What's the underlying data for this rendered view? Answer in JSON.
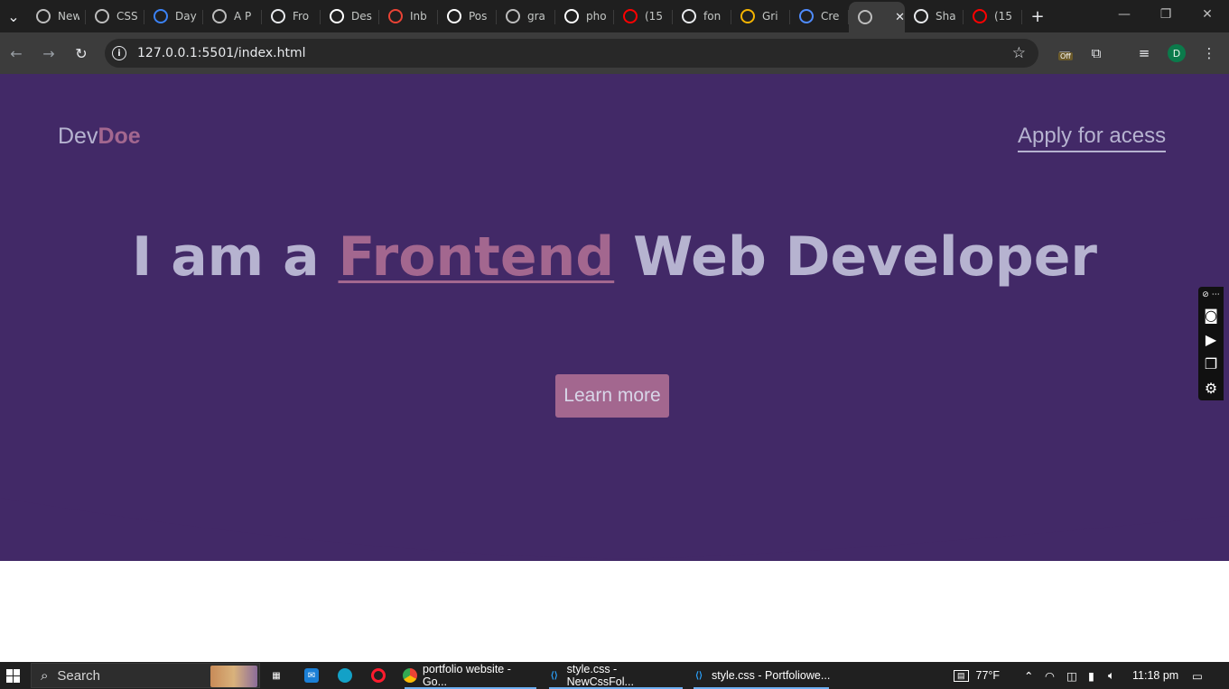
{
  "browser": {
    "tabs": [
      {
        "title": "New",
        "icon": "chrome-icon",
        "color": "#bdbdbd"
      },
      {
        "title": "CSS",
        "icon": "m-logo-icon",
        "color": "#bdbdbd"
      },
      {
        "title": "Day",
        "icon": "globe-blue-icon",
        "color": "#3b82f6"
      },
      {
        "title": "A P",
        "icon": "openai-icon",
        "color": "#bdbdbd"
      },
      {
        "title": "Fro",
        "icon": "doc-icon",
        "color": "#e8eaed"
      },
      {
        "title": "Des",
        "icon": "github-icon",
        "color": "#ffffff"
      },
      {
        "title": "Inb",
        "icon": "gmail-icon",
        "color": "#ea4335"
      },
      {
        "title": "Pos",
        "icon": "medium-icon",
        "color": "#ffffff"
      },
      {
        "title": "gra",
        "icon": "globe-icon",
        "color": "#bdbdbd"
      },
      {
        "title": "pho",
        "icon": "unsplash-icon",
        "color": "#ffffff"
      },
      {
        "title": "(15",
        "icon": "youtube-icon",
        "color": "#ff0000"
      },
      {
        "title": "fon",
        "icon": "code-icon",
        "color": "#e8eaed"
      },
      {
        "title": "Gri",
        "icon": "medal-icon",
        "color": "#f5b400"
      },
      {
        "title": "Cre",
        "icon": "c-logo-icon",
        "color": "#4f8cff"
      },
      {
        "title": "",
        "icon": "globe-icon",
        "color": "#bdbdbd",
        "active": true
      },
      {
        "title": "Sha",
        "icon": "blob-icon",
        "color": "#e8eaed"
      },
      {
        "title": "(15",
        "icon": "youtube-icon",
        "color": "#ff0000"
      }
    ],
    "url": "127.0.0.1:5501/index.html",
    "avatar_initial": "D",
    "extension_badge": "Off"
  },
  "page": {
    "logo_prefix": "Dev",
    "logo_accent": "Doe",
    "nav_link": "Apply for acess",
    "headline_before": "I am a",
    "headline_highlight": "Frontend",
    "headline_after": "Web Developer",
    "cta_label": "Learn more",
    "colors": {
      "hero_bg": "#422967",
      "text": "#b6b3d0",
      "accent": "#a3678f"
    }
  },
  "taskbar": {
    "search_label": "Search",
    "apps": [
      {
        "label": "portfolio website - Go...",
        "icon": "chrome-icon"
      },
      {
        "label": "style.css - NewCssFol...",
        "icon": "vscode-icon"
      },
      {
        "label": "style.css - Portfoliowe...",
        "icon": "vscode-icon"
      }
    ],
    "weather": "77°F",
    "time": "11:18 pm"
  }
}
